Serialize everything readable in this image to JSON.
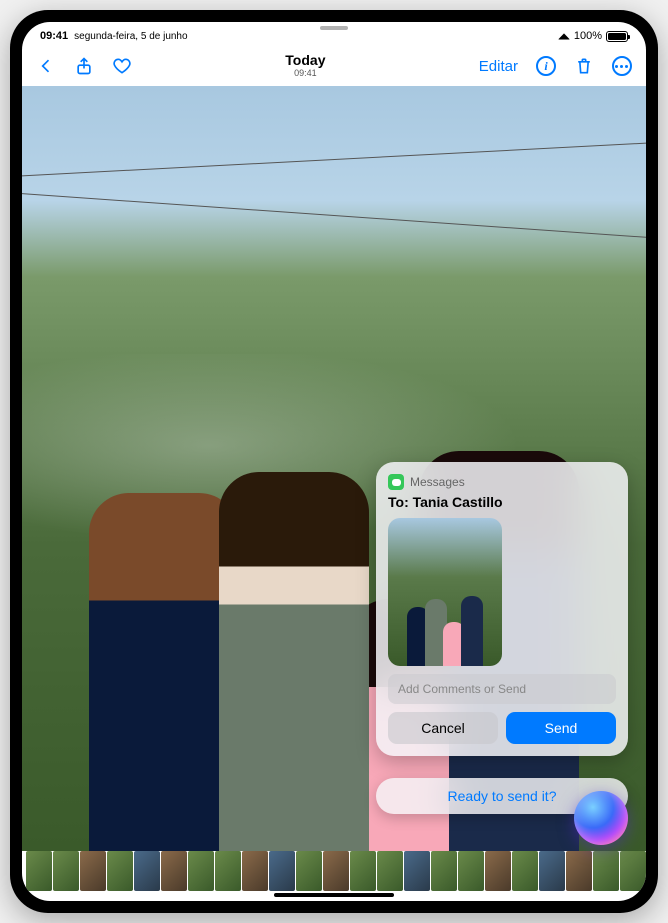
{
  "status": {
    "time": "09:41",
    "date": "segunda-feira, 5 de junho",
    "battery_pct": "100%"
  },
  "nav": {
    "title": "Today",
    "subtitle": "09:41",
    "edit_label": "Editar"
  },
  "siri": {
    "app_name": "Messages",
    "to_label": "To: Tania Castillo",
    "input_placeholder": "Add Comments or Send",
    "cancel_label": "Cancel",
    "send_label": "Send",
    "prompt": "Ready to send it?"
  }
}
